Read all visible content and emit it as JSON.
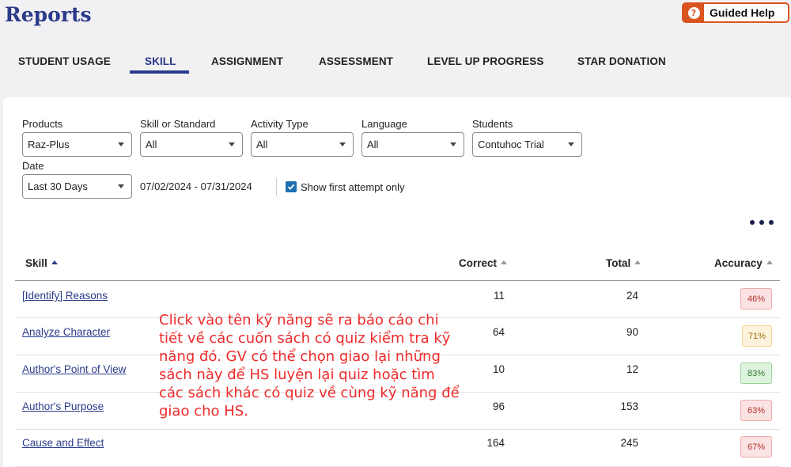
{
  "header": {
    "title": "Reports",
    "guided_help_label": "Guided Help",
    "guided_help_icon": "question-icon"
  },
  "tabs": [
    {
      "label": "STUDENT USAGE",
      "active": false
    },
    {
      "label": "SKILL",
      "active": true
    },
    {
      "label": "ASSIGNMENT",
      "active": false
    },
    {
      "label": "ASSESSMENT",
      "active": false
    },
    {
      "label": "LEVEL UP PROGRESS",
      "active": false
    },
    {
      "label": "STAR DONATION",
      "active": false
    }
  ],
  "filters": {
    "products": {
      "label": "Products",
      "value": "Raz-Plus"
    },
    "skill_or_standard": {
      "label": "Skill or Standard",
      "value": "All"
    },
    "activity_type": {
      "label": "Activity Type",
      "value": "All"
    },
    "language": {
      "label": "Language",
      "value": "All"
    },
    "students": {
      "label": "Students",
      "value": "Contuhoc Trial"
    },
    "date": {
      "label": "Date",
      "value": "Last 30 Days"
    },
    "date_range": "07/02/2024 - 07/31/2024",
    "show_first_attempt": {
      "label": "Show first attempt only",
      "checked": true
    }
  },
  "table": {
    "columns": [
      "Skill",
      "Correct",
      "Total",
      "Accuracy"
    ],
    "rows": [
      {
        "skill": "[Identify] Reasons",
        "correct": "11",
        "total": "24",
        "accuracy": "46%",
        "level": "low"
      },
      {
        "skill": "Analyze Character",
        "correct": "64",
        "total": "90",
        "accuracy": "71%",
        "level": "mid"
      },
      {
        "skill": "Author's Point of View",
        "correct": "10",
        "total": "12",
        "accuracy": "83%",
        "level": "high"
      },
      {
        "skill": "Author's Purpose",
        "correct": "96",
        "total": "153",
        "accuracy": "63%",
        "level": "low"
      },
      {
        "skill": "Cause and Effect",
        "correct": "164",
        "total": "245",
        "accuracy": "67%",
        "level": "low"
      }
    ]
  },
  "annotation": "Click vào tên kỹ năng sẽ ra báo cáo chi tiết về các cuốn sách có quiz kiểm tra kỹ năng đó. GV có thể chọn giao lại những sách này để HS luyện lại quiz hoặc tìm các sách khác có quiz về cùng kỹ năng để giao cho HS.",
  "colors": {
    "brand": "#2b3b8a",
    "help_orange": "#d9541e",
    "badge_low_bg": "#fbe3e3",
    "badge_low_border": "#f0a9a9",
    "badge_low_text": "#b0302c",
    "badge_mid_bg": "#fdf3dc",
    "badge_mid_border": "#f2d58f",
    "badge_mid_text": "#a06a0e",
    "badge_high_bg": "#def3de",
    "badge_high_border": "#99d39a",
    "badge_high_text": "#2e7a31",
    "annotation": "#ee2a2a"
  }
}
